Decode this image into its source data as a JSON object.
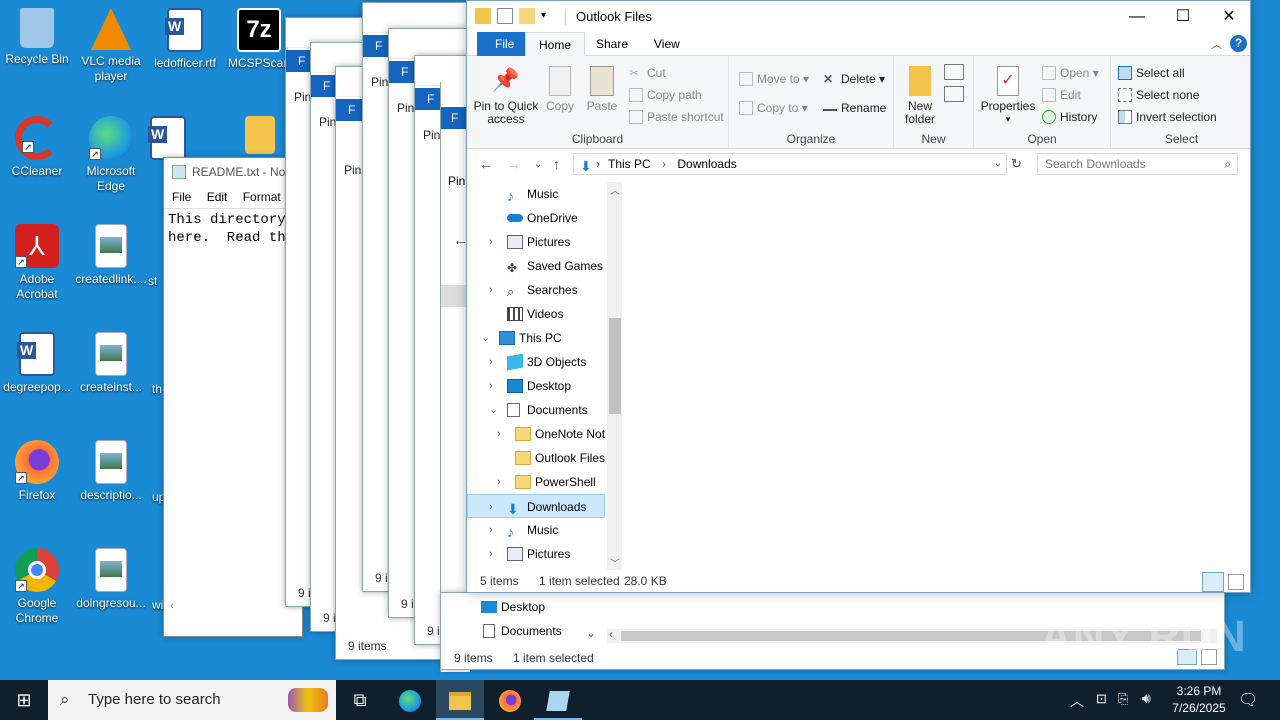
{
  "desktop": {
    "icons": [
      {
        "label": "Recycle Bin",
        "icon": "recycle-bin-icon",
        "color": "#9fc6e6"
      },
      {
        "label": "VLC media player",
        "icon": "vlc-icon",
        "color": "#f08a00"
      },
      {
        "label": "ledofficer.rtf",
        "icon": "word-doc-icon",
        "color": "#2b579a"
      },
      {
        "label": "MCSPScan",
        "icon": "7zip-icon",
        "color": "#000000"
      },
      {
        "label": "CCleaner",
        "icon": "ccleaner-icon",
        "color": "#d9352b"
      },
      {
        "label": "Microsoft Edge",
        "icon": "edge-icon",
        "color": "#1e9be0"
      },
      {
        "label": "st",
        "icon": "word-doc-icon",
        "color": "#2b579a"
      },
      {
        "label": "Adobe Acrobat",
        "icon": "acrobat-icon",
        "color": "#d41f1f"
      },
      {
        "label": "createdlink....",
        "icon": "image-file-icon",
        "color": "#e8eef4"
      },
      {
        "label": "st",
        "icon": "folder-icon",
        "color": "#f2c44c"
      },
      {
        "label": "degreepop...",
        "icon": "word-doc-icon",
        "color": "#2b579a"
      },
      {
        "label": "createinst...",
        "icon": "image-file-icon",
        "color": "#e8eef4"
      },
      {
        "label": "th",
        "icon": "file-icon",
        "color": "#ffffff"
      },
      {
        "label": "Firefox",
        "icon": "firefox-icon",
        "color": "#ff7139"
      },
      {
        "label": "descriptio...",
        "icon": "image-file-icon",
        "color": "#e8eef4"
      },
      {
        "label": "up",
        "icon": "file-icon",
        "color": "#ffffff"
      },
      {
        "label": "Google Chrome",
        "icon": "chrome-icon",
        "color": "#4285f4"
      },
      {
        "label": "doingresou...",
        "icon": "image-file-icon",
        "color": "#e8eef4"
      },
      {
        "label": "wi",
        "icon": "file-icon",
        "color": "#ffffff"
      }
    ]
  },
  "notepad": {
    "title": "README.txt - No",
    "menu": [
      "File",
      "Edit",
      "Format"
    ],
    "text_line1": "This directory",
    "text_line2": "here.  Read the"
  },
  "stacked_windows": {
    "ribbon_letter": "F",
    "pin_label": "Pin",
    "footer_texts": [
      "9 i",
      "9 i",
      "9 items",
      "9 i",
      "9 i",
      "9 i"
    ]
  },
  "behind_window": {
    "nav": [
      "Desktop",
      "Documents"
    ],
    "status_count": "9 items",
    "status_selected": "1 item selected"
  },
  "explorer": {
    "title": "Outlook Files",
    "tabs": [
      "File",
      "Home",
      "Share",
      "View"
    ],
    "ribbon": {
      "clipboard": {
        "group_label": "Clipboard",
        "pin_to_quick_access": "Pin to Quick access",
        "copy": "Copy",
        "paste": "Paste",
        "cut": "Cut",
        "copy_path": "Copy path",
        "paste_shortcut": "Paste shortcut"
      },
      "organize": {
        "group_label": "Organize",
        "move_to": "Move to",
        "copy_to": "Copy to",
        "delete": "Delete",
        "rename": "Rename"
      },
      "new": {
        "group_label": "New",
        "new_folder": "New folder"
      },
      "open": {
        "group_label": "Open",
        "properties": "Properties",
        "open": "Open",
        "edit": "Edit",
        "history": "History"
      },
      "select": {
        "group_label": "Select",
        "select_all": "Select all",
        "select_none": "Select none",
        "invert_selection": "Invert selection"
      }
    },
    "address": {
      "crumbs": [
        "This PC",
        "Downloads"
      ],
      "search_placeholder": "Search Downloads"
    },
    "nav_items": [
      {
        "label": "Music",
        "icon": "music-icon"
      },
      {
        "label": "OneDrive",
        "icon": "onedrive-icon"
      },
      {
        "label": "Pictures",
        "icon": "pictures-icon"
      },
      {
        "label": "Saved Games",
        "icon": "saved-games-icon"
      },
      {
        "label": "Searches",
        "icon": "search-icon"
      },
      {
        "label": "Videos",
        "icon": "videos-icon"
      },
      {
        "label": "This PC",
        "icon": "computer-icon"
      },
      {
        "label": "3D Objects",
        "icon": "3d-objects-icon"
      },
      {
        "label": "Desktop",
        "icon": "desktop-icon"
      },
      {
        "label": "Documents",
        "icon": "documents-icon"
      },
      {
        "label": "OneNote Not",
        "icon": "folder-icon"
      },
      {
        "label": "Outlook Files",
        "icon": "folder-icon"
      },
      {
        "label": "PowerShell",
        "icon": "folder-icon"
      },
      {
        "label": "Downloads",
        "icon": "downloads-icon"
      },
      {
        "label": "Music",
        "icon": "music-icon"
      },
      {
        "label": "Pictures",
        "icon": "pictures-icon"
      }
    ],
    "status": {
      "count": "5 items",
      "selected": "1 item selected",
      "size": "28.0 KB"
    },
    "colors": {
      "accent": "#1a6fc7",
      "selection": "#cce8ff"
    }
  },
  "taskbar": {
    "search_placeholder": "Type here to search",
    "time": "3:26 PM",
    "date": "7/26/2025"
  },
  "watermark": "ANY RUN"
}
